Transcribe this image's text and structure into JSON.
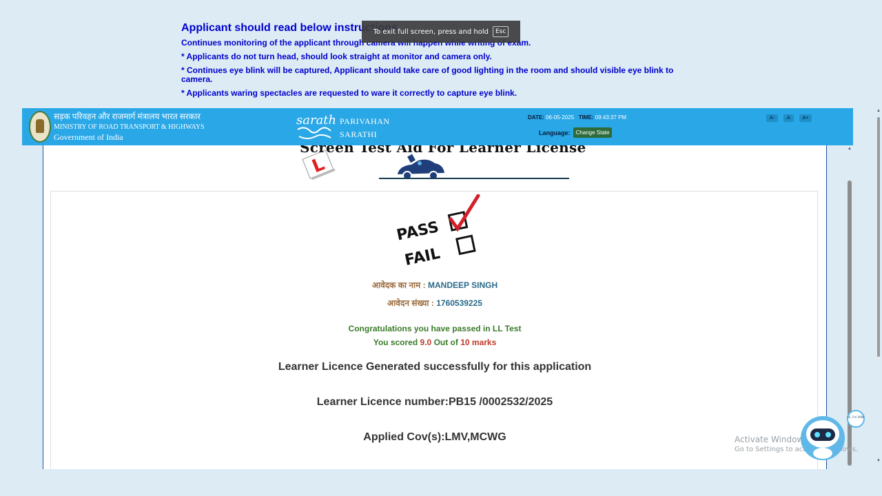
{
  "instructions": {
    "title": "Applicant should read below instructions",
    "lines": [
      "Continues monitoring of the applicant through camera will happen while writing of exam.",
      "* Applicants do not turn head, should look straight at monitor and camera only.",
      "* Continues eye blink will be captured, Applicant should take care of good lighting in the room and should visible eye blink to camera.",
      "* Applicants waring spectacles are requested to ware it correctly to capture eye blink."
    ]
  },
  "fullscreen_toast": {
    "text": "To exit full screen, press and hold",
    "key": "Esc"
  },
  "header": {
    "ministry_hindi": "सड़क परिवहन और राजमार्ग मंत्रालय भारत सरकार",
    "ministry_english": "MINISTRY OF ROAD TRANSPORT & HIGHWAYS",
    "government": "Government of India",
    "logo_text": "sarathi",
    "parivahan": "PARIVAHAN",
    "sarathi": "SARATHI",
    "date_label": "DATE:",
    "date_value": "06-05-2025",
    "time_label": "TIME:",
    "time_value": "09:43:37 PM",
    "language_label": "Language:",
    "change_state": "Change State",
    "font_small": "A-",
    "font_normal": "A",
    "font_large": "A+"
  },
  "page": {
    "heading": "Screen Test Aid For Learner License",
    "l_plate": "L",
    "pass_label": "PASS",
    "fail_label": "FAIL",
    "applicant_name_label": "आवेदक का नाम :",
    "applicant_name": "MANDEEP SINGH",
    "application_no_label": "आवेदन संख्या :",
    "application_no": "1760539225",
    "congrats": "Congratulations you have passed in LL Test",
    "scored_prefix": "You scored",
    "score": "9.0",
    "out_of": "Out of",
    "total": "10 marks",
    "licence_generated": "Learner Licence Generated successfully for this application",
    "licence_number": "Learner Licence number:PB15 /0002532/2025",
    "applied_cov": "Applied Cov(s):LMV,MCWG"
  },
  "windows": {
    "activate_title": "Activate Windows",
    "activate_sub": "Go to Settings to activate Windows."
  },
  "chatbot": {
    "bubble": "Hi, I'm VANI"
  },
  "colors": {
    "header_bg": "#29a7e6",
    "page_bg": "#dcebf4",
    "instructions": "#0000cc",
    "change_state_bg": "#2e6b3a"
  }
}
